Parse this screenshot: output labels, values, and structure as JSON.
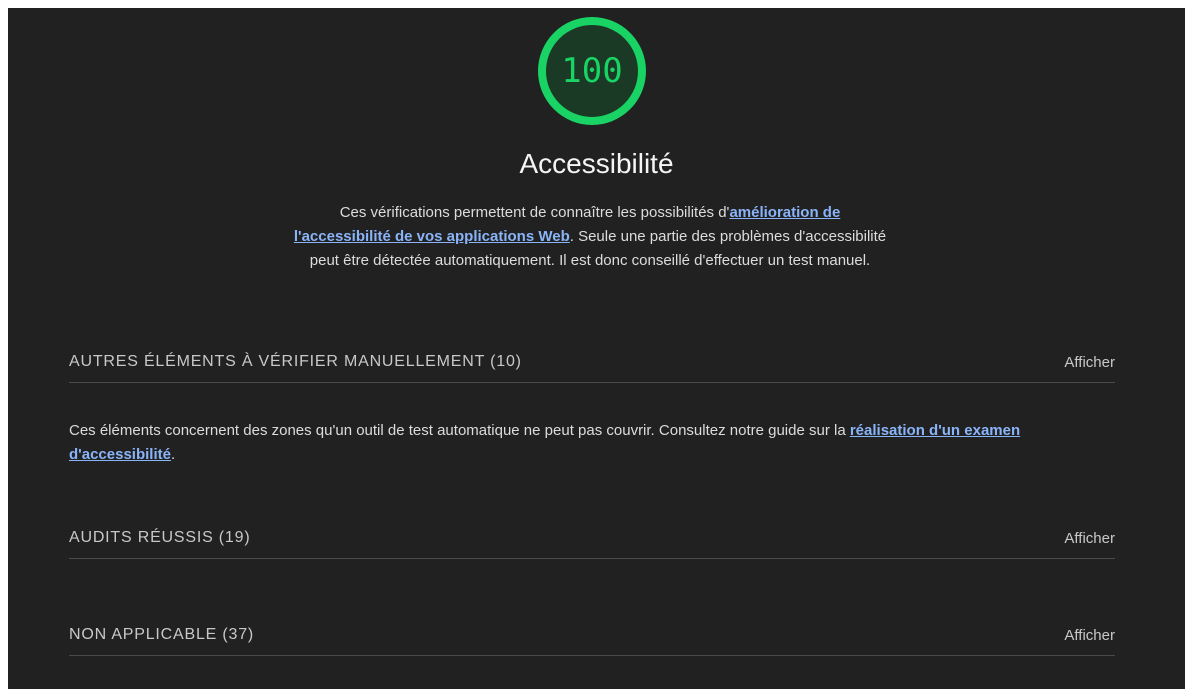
{
  "score": {
    "value": "100",
    "fraction": 1.0,
    "color": "#19d364"
  },
  "category": {
    "title": "Accessibilité",
    "description": {
      "text_before": "Ces vérifications permettent de connaître les possibilités d'",
      "link_text": "amélioration de l'accessibilité de vos applications Web",
      "text_after": ". Seule une partie des problèmes d'accessibilité peut être détectée automatiquement. Il est donc conseillé d'effectuer un test manuel."
    }
  },
  "groups": {
    "manual": {
      "title": "AUTRES ÉLÉMENTS À VÉRIFIER MANUELLEMENT (10)",
      "toggle": "Afficher",
      "description": {
        "text_before": "Ces éléments concernent des zones qu'un outil de test automatique ne peut pas couvrir. Consultez notre guide sur la ",
        "link_text": "réalisation d'un examen d'accessibilité",
        "text_after": "."
      }
    },
    "passed": {
      "title": "AUDITS RÉUSSIS (19)",
      "toggle": "Afficher"
    },
    "not_applicable": {
      "title": "NON APPLICABLE (37)",
      "toggle": "Afficher"
    }
  }
}
